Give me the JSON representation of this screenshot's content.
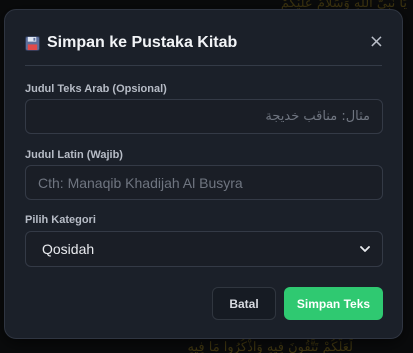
{
  "modal": {
    "title": "Simpan ke Pustaka Kitab",
    "close_label": "×"
  },
  "fields": {
    "arab": {
      "label": "Judul Teks Arab (Opsional)",
      "placeholder": "مثال: مناقب خديجة",
      "value": ""
    },
    "latin": {
      "label": "Judul Latin (Wajib)",
      "placeholder": "Cth: Manaqib Khadijah Al Busyra",
      "value": ""
    },
    "category": {
      "label": "Pilih Kategori",
      "selected": "Qosidah"
    }
  },
  "buttons": {
    "cancel_label": "Batal",
    "save_label": "Simpan Teks"
  },
  "colors": {
    "modal_bg": "#1b2029",
    "save_button": "#2fc971",
    "cancel_button": "#161b23"
  },
  "icons": {
    "title_icon": "floppy-disk-icon",
    "close_icon": "close-icon",
    "select_icon": "chevron-down-icon"
  }
}
